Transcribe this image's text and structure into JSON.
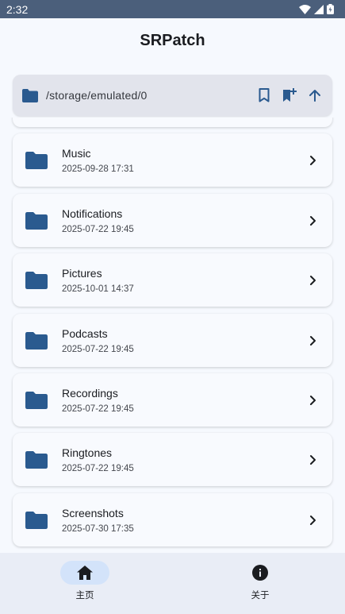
{
  "status_bar": {
    "time": "2:32"
  },
  "app": {
    "title": "SRPatch"
  },
  "path_bar": {
    "path": "/storage/emulated/0"
  },
  "folders": [
    {
      "name": "Music",
      "date": "2025-09-28 17:31"
    },
    {
      "name": "Notifications",
      "date": "2025-07-22 19:45"
    },
    {
      "name": "Pictures",
      "date": "2025-10-01 14:37"
    },
    {
      "name": "Podcasts",
      "date": "2025-07-22 19:45"
    },
    {
      "name": "Recordings",
      "date": "2025-07-22 19:45"
    },
    {
      "name": "Ringtones",
      "date": "2025-07-22 19:45"
    },
    {
      "name": "Screenshots",
      "date": "2025-07-30 17:35"
    }
  ],
  "bottom_nav": {
    "items": [
      {
        "label": "主页",
        "icon": "home-icon",
        "active": true
      },
      {
        "label": "关于",
        "icon": "info-icon",
        "active": false
      }
    ]
  },
  "colors": {
    "accent": "#2a5a8f",
    "background": "#f6f9fe",
    "status_bar": "#4b5f7b",
    "nav_active_pill": "#d3e3fa"
  }
}
